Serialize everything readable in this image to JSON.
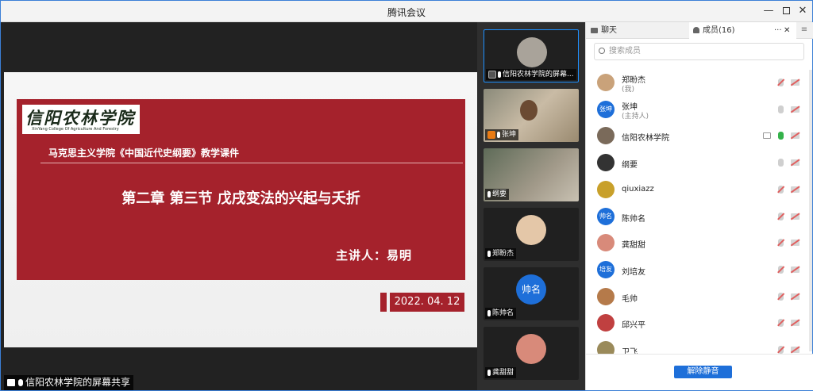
{
  "window": {
    "title": "腾讯会议",
    "min_glyph": "—",
    "close_glyph": "✕"
  },
  "slide": {
    "logo_cn": "信阳农林学院",
    "logo_en": "XinYang College Of Agriculture And Forestry",
    "subtitle": "马克思主义学院《中国近代史纲要》教学课件",
    "title": "第二章 第三节 戊戌变法的兴起与夭折",
    "lecturer": "主讲人：易明",
    "date": "2022. 04. 12"
  },
  "share_label": "信阳农林学院的屏幕共享",
  "videos": [
    {
      "label": "信阳农林学院的屏幕..."
    },
    {
      "label": "张坤"
    },
    {
      "label": "纲要"
    },
    {
      "label": "郑盼杰"
    },
    {
      "label": "陈帅名",
      "avatar_text": "帅名"
    },
    {
      "label": "龚甜甜"
    }
  ],
  "panel": {
    "tab_chat": "聊天",
    "tab_members": "成员(16)",
    "more_glyph": "···",
    "close_glyph": "✕",
    "menu_glyph": "≡",
    "search_placeholder": "搜索成员",
    "unmute_button": "解除静音"
  },
  "members": [
    {
      "name": "郑盼杰",
      "sub": "(我)",
      "mic": "off",
      "avatar_color": "#c9a27a"
    },
    {
      "name": "张坤",
      "sub": "(主持人)",
      "avatar_text": "张坤",
      "mic": "idle",
      "avatar_color": "#1e6fd9"
    },
    {
      "name": "信阳农林学院",
      "mic": "on",
      "screen": true,
      "avatar_color": "#7a6a5a"
    },
    {
      "name": "纲要",
      "mic": "idle",
      "avatar_color": "#333333"
    },
    {
      "name": "qiuxiazz",
      "mic": "off",
      "avatar_color": "#c8a02a"
    },
    {
      "name": "陈帅名",
      "avatar_text": "帅名",
      "mic": "off",
      "avatar_color": "#1e6fd9"
    },
    {
      "name": "龚甜甜",
      "mic": "off",
      "avatar_color": "#d88a7a"
    },
    {
      "name": "刘培友",
      "avatar_text": "培友",
      "mic": "off",
      "avatar_color": "#1e6fd9"
    },
    {
      "name": "毛帅",
      "mic": "off",
      "avatar_color": "#b57a4a"
    },
    {
      "name": "邱兴平",
      "mic": "off",
      "avatar_color": "#c04040"
    },
    {
      "name": "卫飞",
      "mic": "off",
      "avatar_color": "#9a8a5a"
    }
  ]
}
